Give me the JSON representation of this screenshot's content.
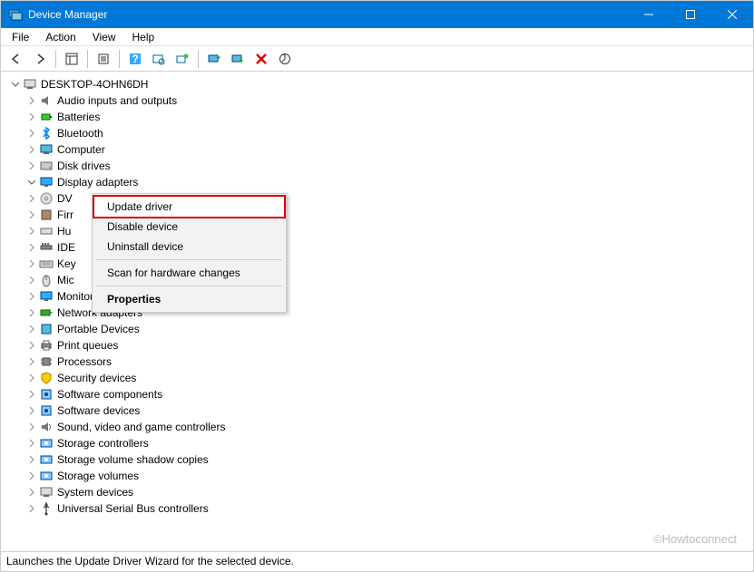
{
  "window": {
    "title": "Device Manager"
  },
  "menu": {
    "file": "File",
    "action": "Action",
    "view": "View",
    "help": "Help"
  },
  "tree": {
    "root": "DESKTOP-4OHN6DH",
    "items": [
      "Audio inputs and outputs",
      "Batteries",
      "Bluetooth",
      "Computer",
      "Disk drives",
      "Display adapters",
      "DV",
      "Firr",
      "Hu",
      "IDE",
      "Key",
      "Mic",
      "Monitors",
      "Network adapters",
      "Portable Devices",
      "Print queues",
      "Processors",
      "Security devices",
      "Software components",
      "Software devices",
      "Sound, video and game controllers",
      "Storage controllers",
      "Storage volume shadow copies",
      "Storage volumes",
      "System devices",
      "Universal Serial Bus controllers"
    ]
  },
  "context_menu": {
    "update": "Update driver",
    "disable": "Disable device",
    "uninstall": "Uninstall device",
    "scan": "Scan for hardware changes",
    "properties": "Properties"
  },
  "status": "Launches the Update Driver Wizard for the selected device.",
  "watermark": "©Howtoconnect"
}
